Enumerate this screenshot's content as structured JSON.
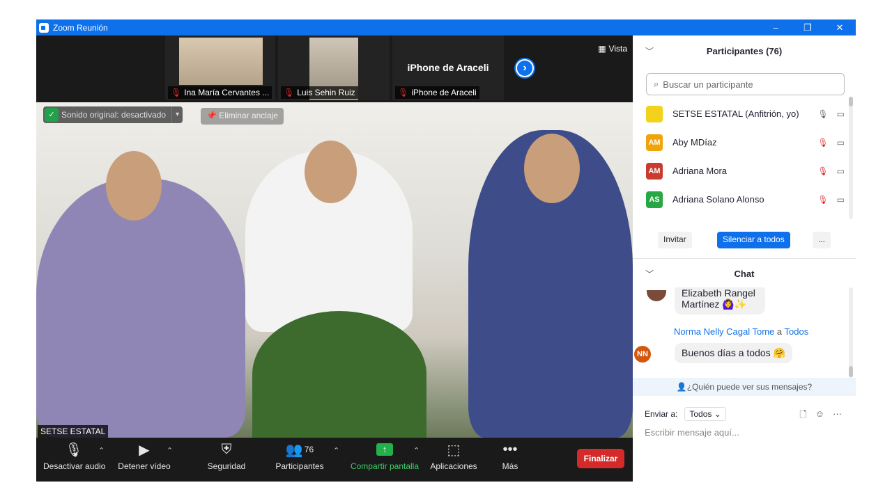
{
  "window": {
    "title": "Zoom Reunión",
    "controls": [
      "–",
      "❐",
      "✕"
    ]
  },
  "strip": {
    "tiles": [
      {
        "name": "Ina María Cervantes ..."
      },
      {
        "name": "Luis Sehin Ruiz"
      },
      {
        "name": "iPhone de Araceli",
        "big": "iPhone de Araceli"
      }
    ],
    "next": "›",
    "view_label": "Vista"
  },
  "main_video": {
    "audio_pill": "Sonido original: desactivado",
    "unpin": "Eliminar anclaje",
    "self_label": "SETSE ESTATAL"
  },
  "toolbar": {
    "mute": "Desactivar audio",
    "video": "Detener vídeo",
    "security": "Seguridad",
    "participants": "Participantes",
    "participants_count": "76",
    "share": "Compartir pantalla",
    "apps": "Aplicaciones",
    "more": "Más",
    "end": "Finalizar"
  },
  "participants": {
    "header": "Participantes (76)",
    "search_placeholder": "Buscar un participante",
    "list": [
      {
        "initials": "",
        "name": "SETSE ESTATAL (Anfitrión, yo)",
        "color": "#f2d21b"
      },
      {
        "initials": "AM",
        "name": "Aby MDíaz",
        "color": "#f0a30a"
      },
      {
        "initials": "AM",
        "name": "Adriana Mora",
        "color": "#c93b2e"
      },
      {
        "initials": "AS",
        "name": "Adriana Solano Alonso",
        "color": "#28a745"
      }
    ],
    "invite": "Invitar",
    "mute_all": "Silenciar a todos",
    "more": "..."
  },
  "chat": {
    "header": "Chat",
    "msg1_text": "Elizabeth Rangel Martínez 🙆‍♀️✨",
    "msg2_sender": "Norma Nelly Cagal Tome",
    "msg2_to": "a",
    "msg2_target": "Todos",
    "msg2_initials": "NN",
    "msg2_text": "Buenos días a todos 🤗",
    "who_can_see": "¿Quién puede ver sus mensajes?",
    "send_to_label": "Enviar a:",
    "send_to_value": "Todos",
    "compose_placeholder": "Escribir mensaje aquí..."
  }
}
